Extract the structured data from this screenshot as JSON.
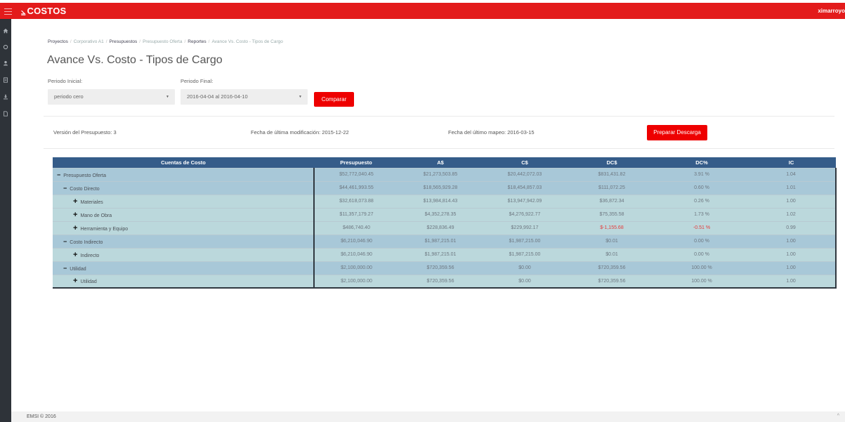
{
  "app": {
    "brand": "COSTOS",
    "brand_mark": "⦥",
    "user": "ximarroyo"
  },
  "sidebar": {
    "icons": [
      "home-icon",
      "circle-icon",
      "user-icon",
      "document-icon",
      "download-icon",
      "file-icon"
    ]
  },
  "breadcrumb": {
    "items": [
      "Proyectos",
      "Corporativo A1",
      "Presupuestos",
      "Presupuesto Oferta",
      "Reportes",
      "Avance Vs. Costo - Tipos de Cargo"
    ],
    "separator": "/"
  },
  "page": {
    "title": "Avance Vs. Costo - Tipos de Cargo"
  },
  "form": {
    "initial_label": "Periodo Inicial:",
    "initial_value": "periodo cero",
    "final_label": "Periodo Final:",
    "final_value": "2016-04-04 al 2016-04-10",
    "compare_button": "Comparar",
    "caret": "▼"
  },
  "info": {
    "version": "Versión del Presupuesto: 3",
    "modified": "Fecha de última modificación: 2015-12-22",
    "mapped": "Fecha del último mapeo: 2016-03-15",
    "download_button": "Preparar Descarga"
  },
  "table": {
    "headers": [
      "Cuentas de Costo",
      "Presupuesto",
      "A$",
      "C$",
      "DC$",
      "DC%",
      "IC"
    ],
    "rows": [
      {
        "name": "Presupuesto Oferta",
        "toggle": "−",
        "level": 0,
        "values": [
          "$52,772,040.45",
          "$21,273,503.85",
          "$20,442,072.03",
          "$831,431.82",
          "3.91 %",
          "1.04"
        ]
      },
      {
        "name": "Costo Directo",
        "toggle": "−",
        "level": 1,
        "values": [
          "$44,461,993.55",
          "$18,565,929.28",
          "$18,454,857.03",
          "$111,072.25",
          "0.60 %",
          "1.01"
        ]
      },
      {
        "name": "Materiales",
        "toggle": "+",
        "level": 2,
        "values": [
          "$32,618,073.88",
          "$13,984,814.43",
          "$13,947,942.09",
          "$36,872.34",
          "0.26 %",
          "1.00"
        ]
      },
      {
        "name": "Mano de Obra",
        "toggle": "+",
        "level": 2,
        "values": [
          "$11,357,179.27",
          "$4,352,278.35",
          "$4,276,922.77",
          "$75,355.58",
          "1.73 %",
          "1.02"
        ]
      },
      {
        "name": "Herramienta y Equipo",
        "toggle": "+",
        "level": 2,
        "values": [
          "$486,740.40",
          "$228,836.49",
          "$229,992.17",
          "$-1,155.68",
          "-0.51 %",
          "0.99"
        ],
        "negative": true
      },
      {
        "name": "Costo Indirecto",
        "toggle": "−",
        "level": 1,
        "values": [
          "$6,210,046.90",
          "$1,987,215.01",
          "$1,987,215.00",
          "$0.01",
          "0.00 %",
          "1.00"
        ]
      },
      {
        "name": "Indirecto",
        "toggle": "+",
        "level": 2,
        "values": [
          "$6,210,046.90",
          "$1,987,215.01",
          "$1,987,215.00",
          "$0.01",
          "0.00 %",
          "1.00"
        ]
      },
      {
        "name": "Utilidad",
        "toggle": "−",
        "level": 1,
        "values": [
          "$2,100,000.00",
          "$720,359.56",
          "$0.00",
          "$720,359.56",
          "100.00 %",
          "1.00"
        ]
      },
      {
        "name": "Utilidad",
        "toggle": "+",
        "level": 2,
        "values": [
          "$2,100,000.00",
          "$720,359.56",
          "$0.00",
          "$720,359.56",
          "100.00 %",
          "1.00"
        ]
      }
    ]
  },
  "footer": {
    "copyright": "EMSI © 2016",
    "scroll_up": "^"
  },
  "colors": {
    "topbar": "#e31b1b",
    "sidebar": "#2e3339",
    "table_header": "#355c89",
    "negative": "#e53b3b"
  }
}
